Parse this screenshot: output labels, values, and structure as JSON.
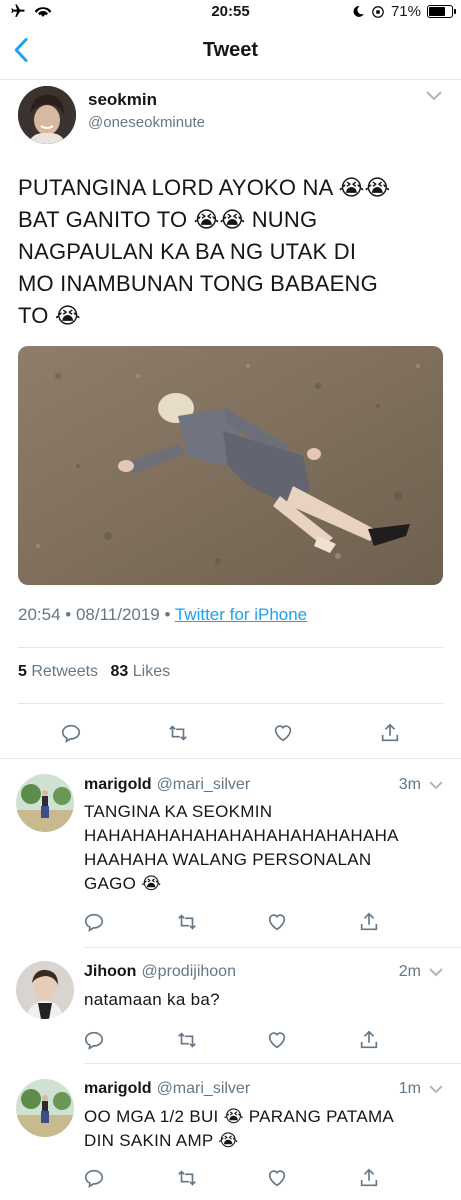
{
  "status_bar": {
    "time": "20:55",
    "battery": "71%",
    "battery_level": 0.71
  },
  "nav": {
    "title": "Tweet"
  },
  "tweet": {
    "author_name": "seokmin",
    "author_handle": "@oneseokminute",
    "text_lines": [
      "PUTANGINA LORD AYOKO NA 😭😭",
      "BAT GANITO TO 😭😭 NUNG",
      "NAGPAULAN KA BA NG UTAK DI",
      "MO INAMBUNAN TONG BABAENG",
      "TO 😭"
    ],
    "timestamp": "20:54 • 08/11/2019 • ",
    "source": "Twitter for iPhone",
    "retweets_count": "5",
    "retweets_label": " Retweets",
    "likes_count": "83",
    "likes_label": " Likes"
  },
  "replies": [
    {
      "name": "marigold",
      "handle": "@mari_silver",
      "time": "3m",
      "text_lines": [
        "TANGINA KA SEOKMIN",
        "HAHAHAHAHAHAHAHAHAHAHAHAHA",
        "HAAHAHA WALANG PERSONALAN",
        "GAGO 😭"
      ]
    },
    {
      "name": "Jihoon",
      "handle": "@prodijihoon",
      "time": "2m",
      "text_lines": [
        "natamaan ka ba?"
      ]
    },
    {
      "name": "marigold",
      "handle": "@mari_silver",
      "time": "1m",
      "text_lines": [
        "OO MGA 1/2 BUI 😭 PARANG PATAMA",
        "DIN SAKIN AMP 😭"
      ]
    }
  ],
  "colors": {
    "accent": "#1da1f2",
    "muted": "#657786",
    "text": "#14171a",
    "divider": "#e1e8ed"
  }
}
